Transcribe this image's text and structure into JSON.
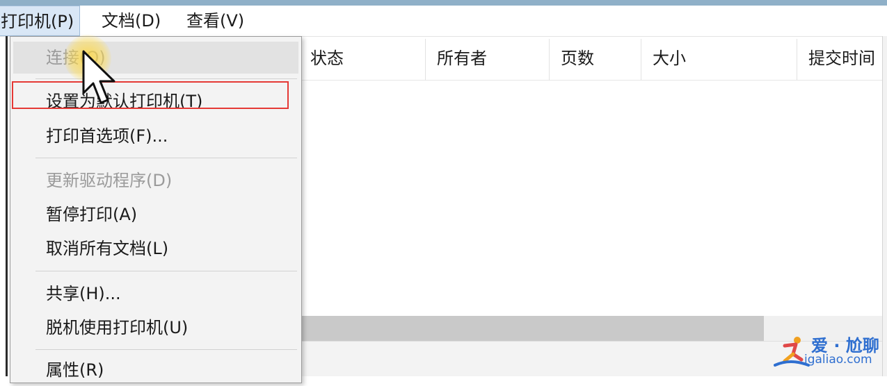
{
  "menubar": {
    "items": [
      {
        "label": "打印机(P)"
      },
      {
        "label": "文档(D)"
      },
      {
        "label": "查看(V)"
      }
    ]
  },
  "dropdown": {
    "items": [
      {
        "label": "连接(O)",
        "state": "disabled-hover"
      },
      {
        "label": "设置为默认打印机(T)",
        "state": "highlighted"
      },
      {
        "label": "打印首选项(F)...",
        "state": "enabled"
      },
      {
        "label": "更新驱动程序(D)",
        "state": "disabled"
      },
      {
        "label": "暂停打印(A)",
        "state": "enabled"
      },
      {
        "label": "取消所有文档(L)",
        "state": "enabled"
      },
      {
        "label": "共享(H)...",
        "state": "enabled"
      },
      {
        "label": "脱机使用打印机(U)",
        "state": "enabled"
      },
      {
        "label": "属性(R)",
        "state": "enabled"
      }
    ]
  },
  "columns": [
    {
      "label": "状态"
    },
    {
      "label": "所有者"
    },
    {
      "label": "页数"
    },
    {
      "label": "大小"
    },
    {
      "label": "提交时间"
    }
  ],
  "watermark": {
    "line1": "爱 · 尬聊",
    "line2": "igaliao.com"
  },
  "colors": {
    "highlight_box": "#e53935",
    "watermark": "#2f6fd0",
    "cursor_halo": "#ffd83c"
  }
}
